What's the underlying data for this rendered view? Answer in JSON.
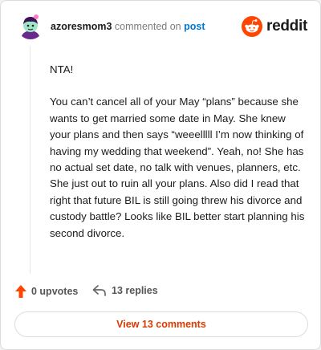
{
  "header": {
    "username": "azoresmom3",
    "action_text": "commented on",
    "post_link": "post",
    "brand": "reddit"
  },
  "comment": {
    "paragraphs": [
      "NTA!",
      "You can’t cancel all of your May “plans” because she wants to get married some date in May. She knew your plans and then says “weeelllll I’m now thinking of having my wedding that weekend”. Yeah, no! She has no actual set date, no talk with venues, planners, etc. She just out to ruin all your plans. Also did I read that right that future BIL is still going threw his divorce and custody battle? Looks like BIL better start planning his second divorce."
    ]
  },
  "actions": {
    "upvotes": "0 upvotes",
    "replies": "13 replies"
  },
  "view_button": "View 13 comments",
  "colors": {
    "accent": "#ff4500",
    "link": "#0079d3",
    "view_text": "#d93a00"
  },
  "icons": {
    "avatar": "avatar-icon",
    "logo": "reddit-logo-icon",
    "upvote": "upvote-arrow-icon",
    "reply": "reply-arrow-icon"
  }
}
